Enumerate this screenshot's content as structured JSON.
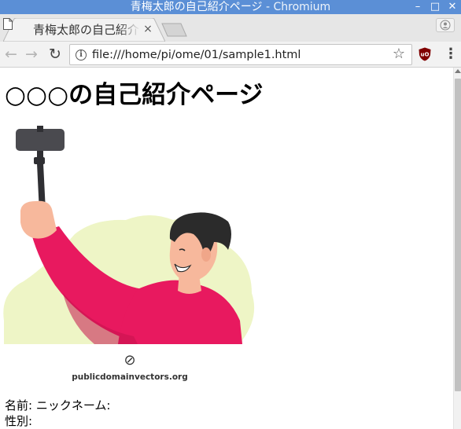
{
  "window": {
    "title_page": "青梅太郎の自己紹介ページ",
    "title_separator": " - ",
    "title_app": "Chromium",
    "min_glyph": "–",
    "max_glyph": "□",
    "close_glyph": "✕"
  },
  "tab": {
    "title": "青梅太郎の自己紹介ページ",
    "close_glyph": "×",
    "icon": "document-icon"
  },
  "toolbar": {
    "back_glyph": "←",
    "forward_glyph": "→",
    "reload_glyph": "↻",
    "info_glyph": "i",
    "url": "file:///home/pi/ome/01/sample1.html",
    "star_glyph": "☆",
    "extension_icon": "ublock-origin-icon",
    "menu_glyph": "⋮"
  },
  "page": {
    "heading": "○○○の自己紹介ページ",
    "image_credit": "publicdomainvectors.org",
    "image_credit_symbol": "⊘",
    "name_line": "名前: ニックネーム:",
    "gender_line": "性別:"
  },
  "colors": {
    "titlebar": "#5b8fd6",
    "tabstrip": "#e6e6e6",
    "toolbar": "#f2f2f2",
    "shirt": "#e8195f",
    "blob": "#eef5c6",
    "skin": "#f7b89c",
    "hair": "#2b2b2b"
  }
}
